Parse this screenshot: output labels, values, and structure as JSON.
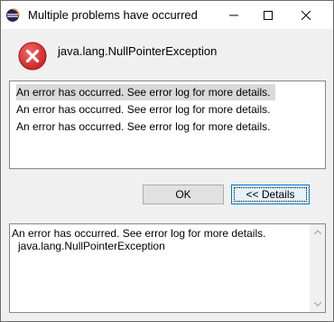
{
  "window": {
    "title": "Multiple problems have occurred"
  },
  "header": {
    "icon": "error-icon",
    "message": "java.lang.NullPointerException"
  },
  "details_list": {
    "items": [
      "An error has occurred. See error log for more details.",
      "An error has occurred. See error log for more details.",
      "An error has occurred. See error log for more details."
    ],
    "selected_index": 0
  },
  "buttons": {
    "ok_label": "OK",
    "details_label": "<< Details"
  },
  "log": {
    "line1": "An error has occurred. See error log for more details.",
    "line2": "java.lang.NullPointerException"
  },
  "colors": {
    "error_red": "#d32f2f",
    "accent_blue": "#0078d7",
    "selection": "#d9d9d9"
  }
}
